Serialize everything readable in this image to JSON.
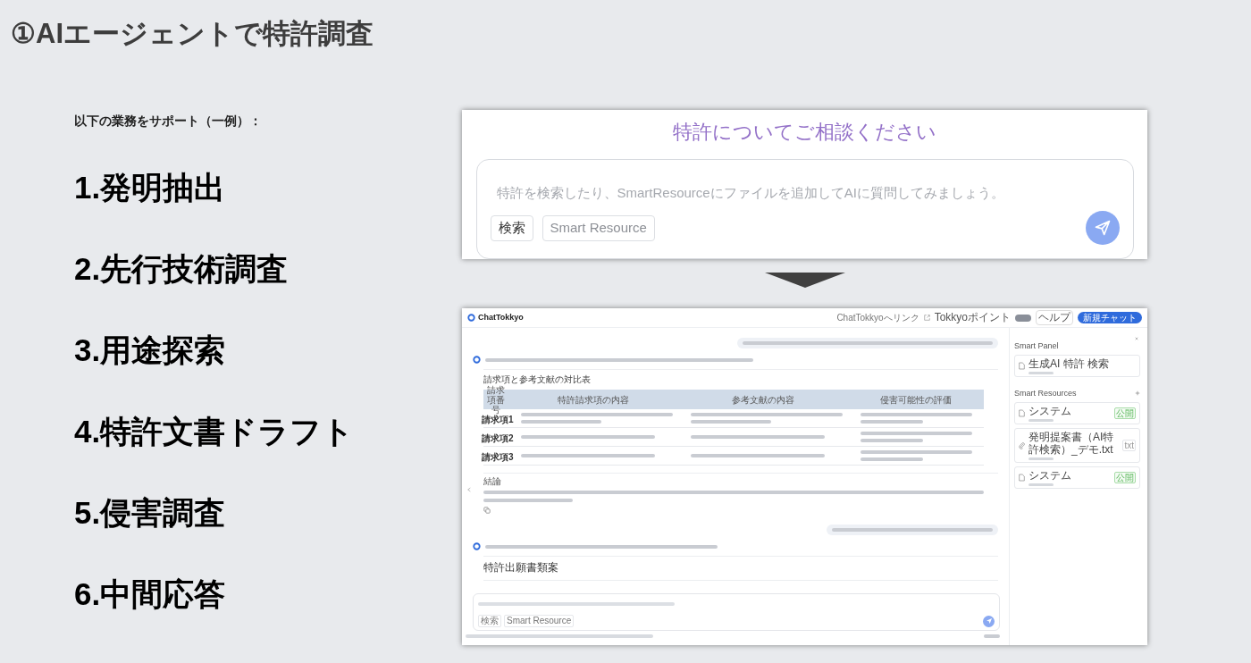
{
  "slide": {
    "title": "①AIエージェントで特許調査",
    "intro": "以下の業務をサポート（一例）：",
    "tasks": [
      "1.発明抽出",
      "2.先行技術調査",
      "3.用途探索",
      "4.特許文書ドラフト",
      "5.侵害調査",
      "6.中間応答"
    ]
  },
  "start_screen": {
    "heading": "特許についてご相談ください",
    "input": {
      "placeholder": "特許を検索したり、SmartResourceにファイルを追加してAIに質問してみましょう。"
    },
    "buttons": [
      "検索",
      "Smart Resource"
    ]
  },
  "chat_screen": {
    "app_name": "ChatTokkyo",
    "header_links": [
      "ChatTokkyoへリンク",
      "Tokkyoポイント",
      "ヘルプ"
    ],
    "new_chat_button": "新規チャット",
    "comparison": {
      "heading": "請求項と参考文献の対比表",
      "columns": [
        "請求項番号",
        "特許請求項の内容",
        "参考文献の内容",
        "侵害可能性の評価"
      ],
      "rows": [
        {
          "claim": "請求項1"
        },
        {
          "claim": "請求項2"
        },
        {
          "claim": "請求項3"
        }
      ]
    },
    "conclusion": {
      "heading": "結論"
    },
    "draft": {
      "heading": "特許出願書類案"
    },
    "input": {
      "buttons": [
        "検索",
        "Smart Resource"
      ]
    },
    "side_panel": {
      "title": "Smart Panel",
      "panel_item": "生成AI 特許 検索",
      "resources_title": "Smart Resources",
      "resources": [
        {
          "kind": "patent",
          "name": "システム",
          "badge": "公開"
        },
        {
          "kind": "file",
          "name": "発明提案書（AI特許検索）_デモ.txt",
          "badge": "txt"
        },
        {
          "kind": "patent",
          "name": "システム",
          "badge": "公開"
        }
      ]
    }
  }
}
